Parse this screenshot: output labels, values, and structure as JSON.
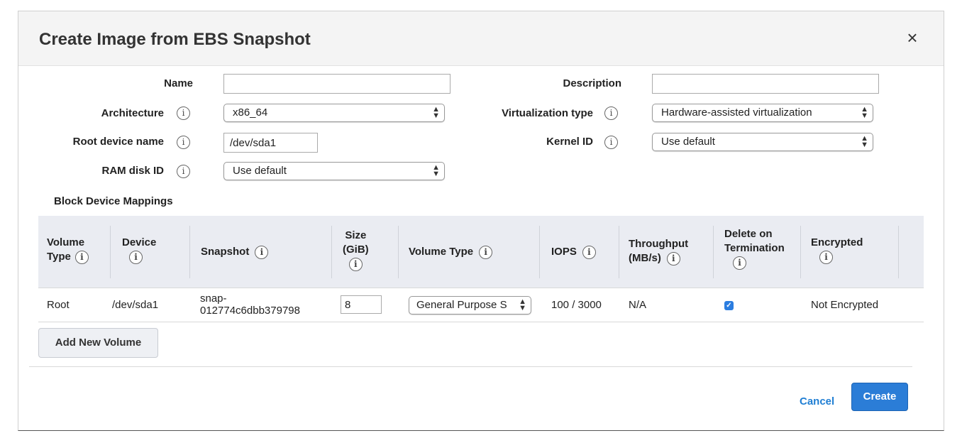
{
  "dialog": {
    "title": "Create Image from EBS Snapshot",
    "close_icon": "×"
  },
  "form": {
    "name": {
      "label": "Name",
      "value": ""
    },
    "description": {
      "label": "Description",
      "value": ""
    },
    "architecture": {
      "label": "Architecture",
      "value": "x86_64"
    },
    "virtualization_type": {
      "label": "Virtualization type",
      "value": "Hardware-assisted virtualization"
    },
    "root_device_name": {
      "label": "Root device name",
      "value": "/dev/sda1"
    },
    "kernel_id": {
      "label": "Kernel ID",
      "value": "Use default"
    },
    "ram_disk_id": {
      "label": "RAM disk ID",
      "value": "Use default"
    }
  },
  "info_icon_glyph": "i",
  "block_device": {
    "title": "Block Device Mappings",
    "headers": {
      "volume_type_a": "Volume",
      "volume_type_b": "Type",
      "device": "Device",
      "snapshot": "Snapshot",
      "size_a": "Size",
      "size_b": "(GiB)",
      "volume_type": "Volume Type",
      "iops": "IOPS",
      "throughput_a": "Throughput",
      "throughput_b": "(MB/s)",
      "delete_a": "Delete on",
      "delete_b": "Termination",
      "encrypted": "Encrypted"
    },
    "rows": [
      {
        "volume_type": "Root",
        "device": "/dev/sda1",
        "snapshot_a": "snap-",
        "snapshot_b": "012774c6dbb379798",
        "size": "8",
        "ebs_volume_type": "General Purpose S",
        "iops": "100 / 3000",
        "throughput": "N/A",
        "delete_on_termination": true,
        "encrypted": "Not Encrypted"
      }
    ],
    "add_button": "Add New Volume"
  },
  "footer": {
    "cancel": "Cancel",
    "create": "Create"
  },
  "colors": {
    "primary": "#2b7dd7",
    "link": "#1f7ed3",
    "table_header_bg": "#eaecf2"
  }
}
